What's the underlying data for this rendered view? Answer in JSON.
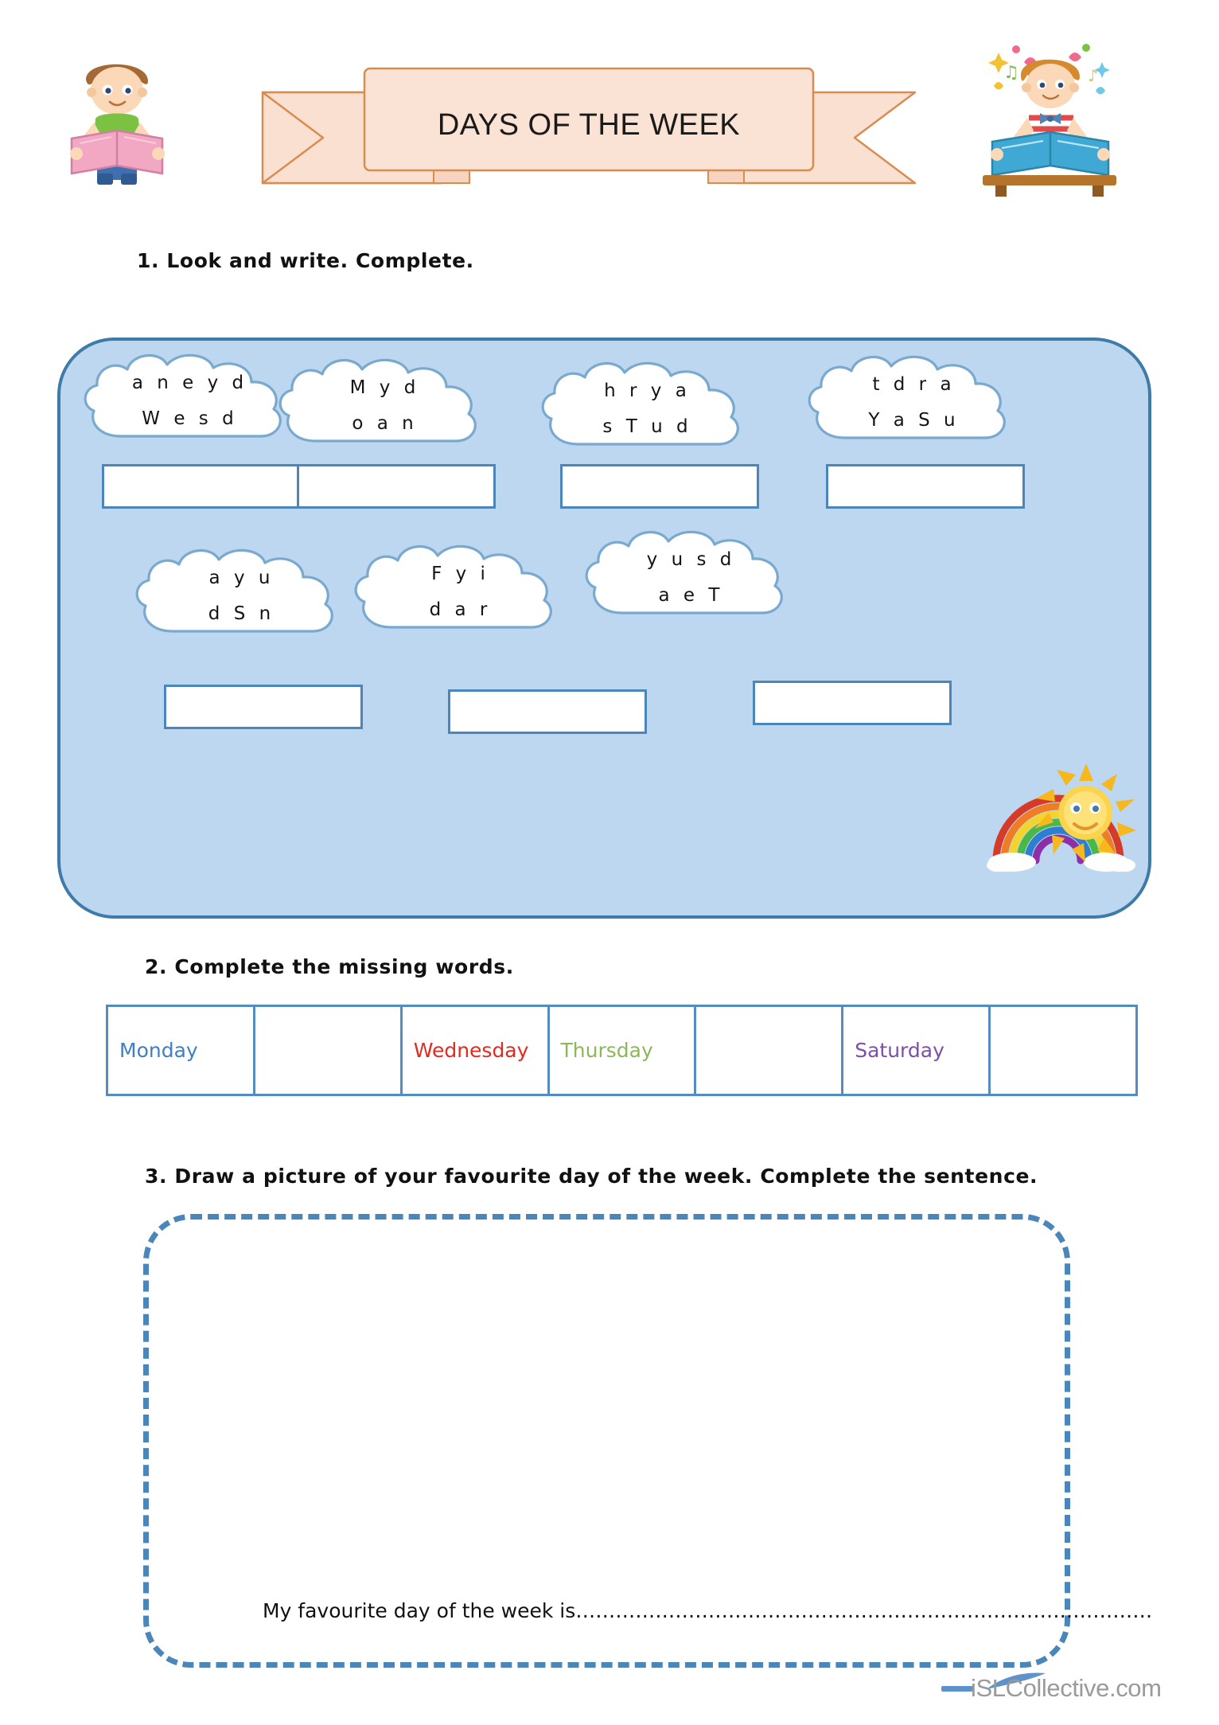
{
  "header": {
    "title": "DAYS OF THE WEEK",
    "left_illustration": "boy-reading-pink-book-icon",
    "right_illustration": "boy-reading-blue-book-icon",
    "banner_fill": "#fae0d0",
    "banner_stroke": "#d98c50"
  },
  "exercises": {
    "one": {
      "number": "1.",
      "instruction": "1.  Look  and  write.  Complete.",
      "panel_fill": "#bcd7ef",
      "panel_stroke": "#3f7ba8",
      "clouds": [
        {
          "line1": "a n e y d",
          "line2": "W e s d"
        },
        {
          "line1": "M y d",
          "line2": "o a n"
        },
        {
          "line1": "h r y a",
          "line2": "s T u d"
        },
        {
          "line1": "t d r a",
          "line2": "Y a S u"
        },
        {
          "line1": "a y u",
          "line2": "d S n"
        },
        {
          "line1": "F y i",
          "line2": "d a r"
        },
        {
          "line1": "y u s d",
          "line2": "a e T"
        }
      ],
      "answer_boxes": [
        "",
        "",
        "",
        "",
        "",
        "",
        ""
      ],
      "decoration": "rainbow-sun-icon"
    },
    "two": {
      "number": "2.",
      "instruction": "2. Complete the missing words.",
      "cells": [
        {
          "text": "Monday",
          "color": "#3f7fc4"
        },
        {
          "text": "",
          "color": "#000000"
        },
        {
          "text": "Wednesday",
          "color": "#e12a20"
        },
        {
          "text": "Thursday",
          "color": "#8cb85a"
        },
        {
          "text": "",
          "color": "#000000"
        },
        {
          "text": "Saturday",
          "color": "#7c4fa8"
        },
        {
          "text": "",
          "color": "#000000"
        }
      ],
      "border_color": "#528cc0"
    },
    "three": {
      "number": "3.",
      "instruction": "3. Draw a picture of your favourite day of the week. Complete the sentence.",
      "sentence": "My favourite day of the week is……………………………………………………………………………",
      "box_border_color": "#4b86bb"
    }
  },
  "footer": {
    "watermark": "iSLCollective.com"
  }
}
